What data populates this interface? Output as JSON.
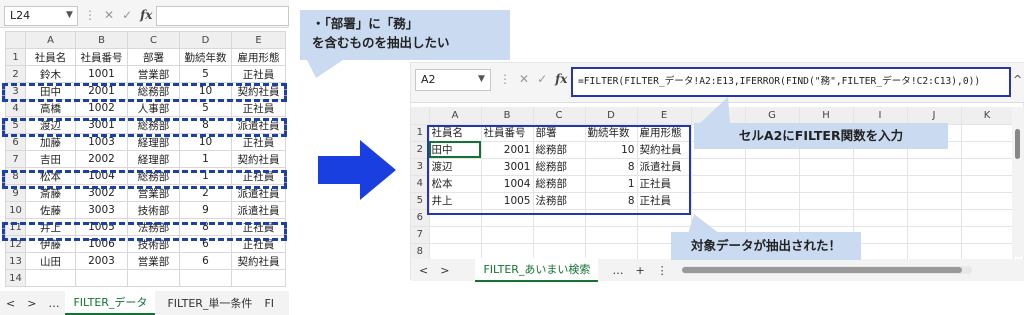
{
  "left": {
    "name_box": "L24",
    "columns": [
      "A",
      "B",
      "C",
      "D",
      "E"
    ],
    "rows": [
      {
        "n": "1",
        "cells": [
          "社員名",
          "社員番号",
          "部署",
          "勤続年数",
          "雇用形態"
        ]
      },
      {
        "n": "2",
        "cells": [
          "鈴木",
          "1001",
          "営業部",
          "5",
          "正社員"
        ]
      },
      {
        "n": "3",
        "cells": [
          "田中",
          "2001",
          "総務部",
          "10",
          "契約社員"
        ]
      },
      {
        "n": "4",
        "cells": [
          "高橋",
          "1002",
          "人事部",
          "5",
          "正社員"
        ]
      },
      {
        "n": "5",
        "cells": [
          "渡辺",
          "3001",
          "総務部",
          "8",
          "派遣社員"
        ]
      },
      {
        "n": "6",
        "cells": [
          "加藤",
          "1003",
          "経理部",
          "10",
          "正社員"
        ]
      },
      {
        "n": "7",
        "cells": [
          "吉田",
          "2002",
          "経理部",
          "1",
          "契約社員"
        ]
      },
      {
        "n": "8",
        "cells": [
          "松本",
          "1004",
          "総務部",
          "1",
          "正社員"
        ]
      },
      {
        "n": "9",
        "cells": [
          "斎藤",
          "3002",
          "営業部",
          "2",
          "派遣社員"
        ]
      },
      {
        "n": "10",
        "cells": [
          "佐藤",
          "3003",
          "技術部",
          "9",
          "派遣社員"
        ]
      },
      {
        "n": "11",
        "cells": [
          "井上",
          "1005",
          "法務部",
          "8",
          "正社員"
        ]
      },
      {
        "n": "12",
        "cells": [
          "伊藤",
          "1006",
          "技術部",
          "6",
          "正社員"
        ]
      },
      {
        "n": "13",
        "cells": [
          "山田",
          "2003",
          "営業部",
          "6",
          "契約社員"
        ]
      },
      {
        "n": "14",
        "cells": [
          "",
          "",
          "",
          "",
          ""
        ]
      }
    ],
    "tabs": {
      "prev": "<",
      "next": ">",
      "more": "…",
      "active": "FILTER_データ",
      "second": "FILTER_単一条件",
      "third": "FI"
    }
  },
  "callouts": {
    "top_line1": "・「部署」に「務」",
    "top_line2": "を含むものを抽出したい",
    "input": "セルA2にFILTER関数を入力",
    "result": "対象データが抽出された！"
  },
  "right": {
    "name_box": "A2",
    "formula": "=FILTER(FILTER_データ!A2:E13,IFERROR(FIND(\"務\",FILTER_データ!C2:C13),0))",
    "columns": [
      "A",
      "B",
      "C",
      "D",
      "E",
      "F",
      "G",
      "H",
      "I",
      "J",
      "K"
    ],
    "rows": [
      {
        "n": "1",
        "cells": [
          "社員名",
          "社員番号",
          "部署",
          "勤続年数",
          "雇用形態"
        ]
      },
      {
        "n": "2",
        "cells": [
          "田中",
          "2001",
          "総務部",
          "10",
          "契約社員"
        ]
      },
      {
        "n": "3",
        "cells": [
          "渡辺",
          "3001",
          "総務部",
          "8",
          "派遣社員"
        ]
      },
      {
        "n": "4",
        "cells": [
          "松本",
          "1004",
          "総務部",
          "1",
          "正社員"
        ]
      },
      {
        "n": "5",
        "cells": [
          "井上",
          "1005",
          "法務部",
          "8",
          "正社員"
        ]
      },
      {
        "n": "6",
        "cells": [
          "",
          "",
          "",
          "",
          ""
        ]
      },
      {
        "n": "7",
        "cells": [
          "",
          "",
          "",
          "",
          ""
        ]
      },
      {
        "n": "8",
        "cells": [
          "",
          "",
          "",
          "",
          ""
        ]
      }
    ],
    "tabs": {
      "prev": "<",
      "next": ">",
      "active": "FILTER_あいまい検索",
      "more": "…",
      "add": "+",
      "menu": "⋮"
    }
  },
  "colors": {
    "accent_blue": "#2436b0",
    "arrow_blue": "#1a3fe0",
    "callout_bg": "#c9daf1",
    "excel_green": "#137333"
  }
}
